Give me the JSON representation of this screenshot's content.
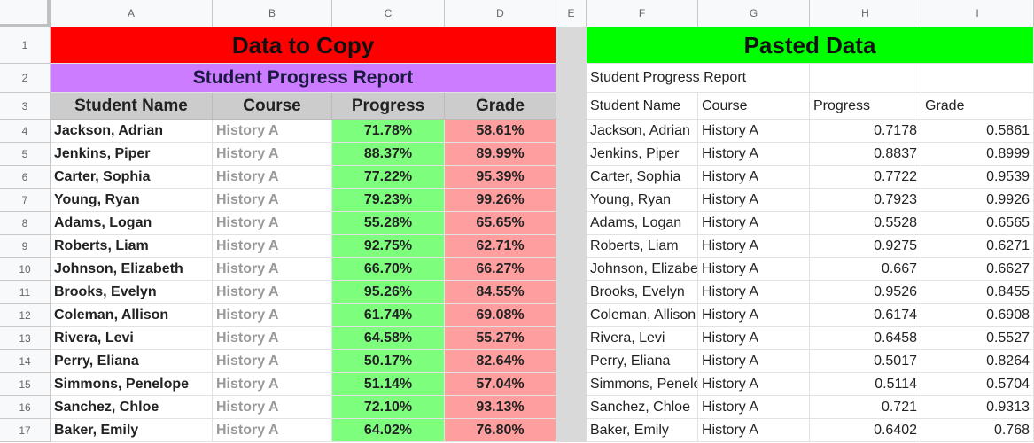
{
  "columns": [
    "A",
    "B",
    "C",
    "D",
    "E",
    "F",
    "G",
    "H",
    "I"
  ],
  "colors": {
    "copy_title_bg": "#ff0000",
    "pasted_title_bg": "#00ff00",
    "subtitle_bg": "#cc7cff",
    "header_bg": "#cccccc",
    "progress_bg": "#7dff7d",
    "grade_bg": "#ff9e9e",
    "separator": "#d9d9d9"
  },
  "left": {
    "title": "Data to Copy",
    "subtitle": "Student Progress Report",
    "headers": [
      "Student Name",
      "Course",
      "Progress",
      "Grade"
    ],
    "rows": [
      [
        "Jackson, Adrian",
        "History A",
        "71.78%",
        "58.61%"
      ],
      [
        "Jenkins, Piper",
        "History A",
        "88.37%",
        "89.99%"
      ],
      [
        "Carter, Sophia",
        "History A",
        "77.22%",
        "95.39%"
      ],
      [
        "Young, Ryan",
        "History A",
        "79.23%",
        "99.26%"
      ],
      [
        "Adams, Logan",
        "History A",
        "55.28%",
        "65.65%"
      ],
      [
        "Roberts, Liam",
        "History A",
        "92.75%",
        "62.71%"
      ],
      [
        "Johnson, Elizabeth",
        "History A",
        "66.70%",
        "66.27%"
      ],
      [
        "Brooks, Evelyn",
        "History A",
        "95.26%",
        "84.55%"
      ],
      [
        "Coleman, Allison",
        "History A",
        "61.74%",
        "69.08%"
      ],
      [
        "Rivera, Levi",
        "History A",
        "64.58%",
        "55.27%"
      ],
      [
        "Perry, Eliana",
        "History A",
        "50.17%",
        "82.64%"
      ],
      [
        "Simmons, Penelope",
        "History A",
        "51.14%",
        "57.04%"
      ],
      [
        "Sanchez, Chloe",
        "History A",
        "72.10%",
        "93.13%"
      ],
      [
        "Baker, Emily",
        "History A",
        "64.02%",
        "76.80%"
      ]
    ]
  },
  "right": {
    "title": "Pasted Data",
    "subtitle": "Student Progress Report",
    "headers": [
      "Student Name",
      "Course",
      "Progress",
      "Grade"
    ],
    "rows": [
      [
        "Jackson, Adrian",
        "History A",
        "0.7178",
        "0.5861"
      ],
      [
        "Jenkins, Piper",
        "History A",
        "0.8837",
        "0.8999"
      ],
      [
        "Carter, Sophia",
        "History A",
        "0.7722",
        "0.9539"
      ],
      [
        "Young, Ryan",
        "History A",
        "0.7923",
        "0.9926"
      ],
      [
        "Adams, Logan",
        "History A",
        "0.5528",
        "0.6565"
      ],
      [
        "Roberts, Liam",
        "History A",
        "0.9275",
        "0.6271"
      ],
      [
        "Johnson, Elizabeth",
        "History A",
        "0.667",
        "0.6627"
      ],
      [
        "Brooks, Evelyn",
        "History A",
        "0.9526",
        "0.8455"
      ],
      [
        "Coleman, Allison",
        "History A",
        "0.6174",
        "0.6908"
      ],
      [
        "Rivera, Levi",
        "History A",
        "0.6458",
        "0.5527"
      ],
      [
        "Perry, Eliana",
        "History A",
        "0.5017",
        "0.8264"
      ],
      [
        "Simmons, Penelope",
        "History A",
        "0.5114",
        "0.5704"
      ],
      [
        "Sanchez, Chloe",
        "History A",
        "0.721",
        "0.9313"
      ],
      [
        "Baker, Emily",
        "History A",
        "0.6402",
        "0.768"
      ]
    ]
  }
}
